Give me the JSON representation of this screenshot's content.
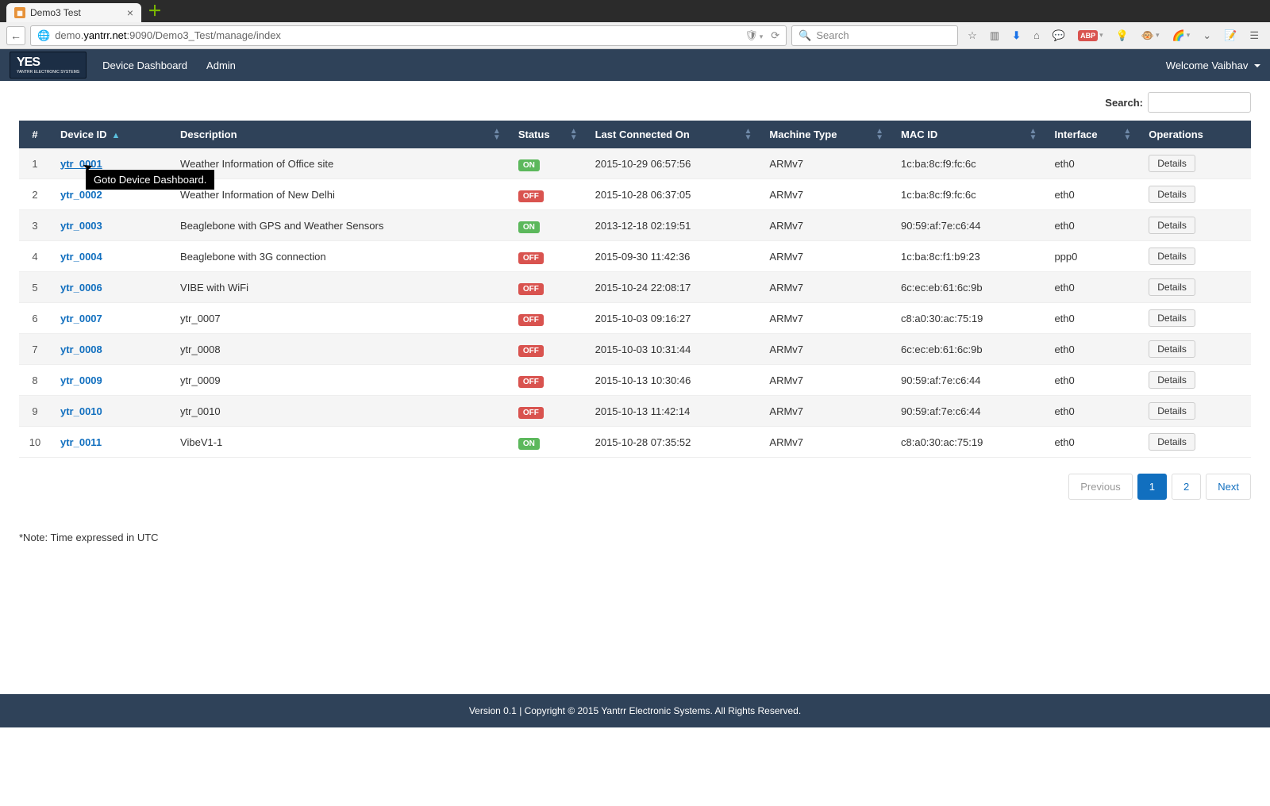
{
  "browser": {
    "tab_title": "Demo3 Test",
    "url_prefix": "demo.",
    "url_domain": "yantrr.net",
    "url_path": ":9090/Demo3_Test/manage/index",
    "search_placeholder": "Search"
  },
  "nav": {
    "logo_text": "YES",
    "logo_sub": "YANTRR ELECTRONIC SYSTEMS",
    "links": [
      "Device Dashboard",
      "Admin"
    ],
    "welcome": "Welcome Vaibhav"
  },
  "search_label": "Search:",
  "columns": {
    "num": "#",
    "device_id": "Device ID",
    "description": "Description",
    "status": "Status",
    "last_connected": "Last Connected On",
    "machine_type": "Machine Type",
    "mac_id": "MAC ID",
    "interface": "Interface",
    "operations": "Operations"
  },
  "details_label": "Details",
  "tooltip_text": "Goto Device Dashboard.",
  "rows": [
    {
      "n": "1",
      "id": "ytr_0001",
      "desc": "Weather Information of Office site",
      "status": "ON",
      "ts": "2015-10-29 06:57:56",
      "mt": "ARMv7",
      "mac": "1c:ba:8c:f9:fc:6c",
      "if": "eth0"
    },
    {
      "n": "2",
      "id": "ytr_0002",
      "desc": "Weather Information of New Delhi",
      "status": "OFF",
      "ts": "2015-10-28 06:37:05",
      "mt": "ARMv7",
      "mac": "1c:ba:8c:f9:fc:6c",
      "if": "eth0"
    },
    {
      "n": "3",
      "id": "ytr_0003",
      "desc": "Beaglebone with GPS and Weather Sensors",
      "status": "ON",
      "ts": "2013-12-18 02:19:51",
      "mt": "ARMv7",
      "mac": "90:59:af:7e:c6:44",
      "if": "eth0"
    },
    {
      "n": "4",
      "id": "ytr_0004",
      "desc": "Beaglebone with 3G connection",
      "status": "OFF",
      "ts": "2015-09-30 11:42:36",
      "mt": "ARMv7",
      "mac": "1c:ba:8c:f1:b9:23",
      "if": "ppp0"
    },
    {
      "n": "5",
      "id": "ytr_0006",
      "desc": "VIBE with WiFi",
      "status": "OFF",
      "ts": "2015-10-24 22:08:17",
      "mt": "ARMv7",
      "mac": "6c:ec:eb:61:6c:9b",
      "if": "eth0"
    },
    {
      "n": "6",
      "id": "ytr_0007",
      "desc": "ytr_0007",
      "status": "OFF",
      "ts": "2015-10-03 09:16:27",
      "mt": "ARMv7",
      "mac": "c8:a0:30:ac:75:19",
      "if": "eth0"
    },
    {
      "n": "7",
      "id": "ytr_0008",
      "desc": "ytr_0008",
      "status": "OFF",
      "ts": "2015-10-03 10:31:44",
      "mt": "ARMv7",
      "mac": "6c:ec:eb:61:6c:9b",
      "if": "eth0"
    },
    {
      "n": "8",
      "id": "ytr_0009",
      "desc": "ytr_0009",
      "status": "OFF",
      "ts": "2015-10-13 10:30:46",
      "mt": "ARMv7",
      "mac": "90:59:af:7e:c6:44",
      "if": "eth0"
    },
    {
      "n": "9",
      "id": "ytr_0010",
      "desc": "ytr_0010",
      "status": "OFF",
      "ts": "2015-10-13 11:42:14",
      "mt": "ARMv7",
      "mac": "90:59:af:7e:c6:44",
      "if": "eth0"
    },
    {
      "n": "10",
      "id": "ytr_0011",
      "desc": "VibeV1-1",
      "status": "ON",
      "ts": "2015-10-28 07:35:52",
      "mt": "ARMv7",
      "mac": "c8:a0:30:ac:75:19",
      "if": "eth0"
    }
  ],
  "pagination": {
    "previous": "Previous",
    "pages": [
      "1",
      "2"
    ],
    "next": "Next",
    "active": "1"
  },
  "note": "*Note: Time expressed in UTC",
  "footer": "Version 0.1 | Copyright © 2015 Yantrr Electronic Systems. All Rights Reserved."
}
